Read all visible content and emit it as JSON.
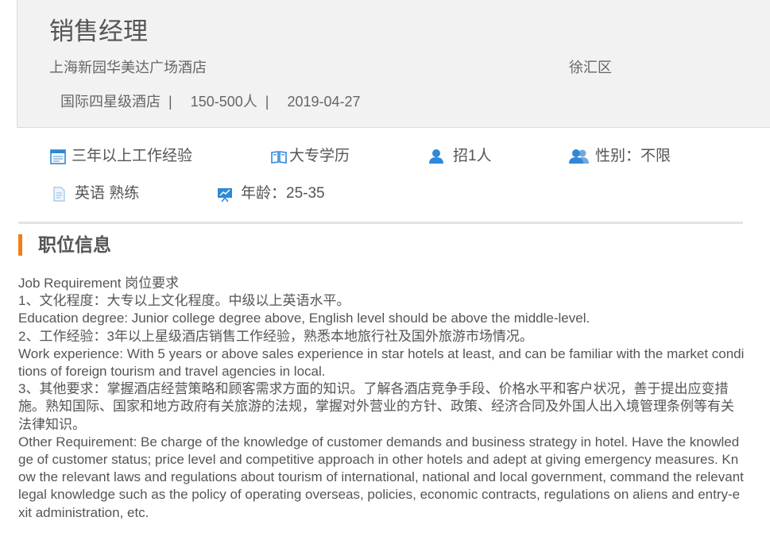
{
  "job": {
    "title": "销售经理",
    "company": "上海新园华美达广场酒店",
    "district": "徐汇区",
    "hotel_type": "国际四星级酒店",
    "sep": "|",
    "size": "150-500人",
    "date": "2019-04-27"
  },
  "attributes": {
    "experience": {
      "icon": "calendar-icon",
      "label": "三年以上工作经验"
    },
    "education": {
      "icon": "book-icon",
      "label": "大专学历"
    },
    "headcount": {
      "icon": "person-icon",
      "label": "招1人"
    },
    "gender": {
      "icon": "people-icon",
      "label": "性别：不限"
    },
    "language": {
      "icon": "document-icon",
      "label": "英语 熟练"
    },
    "age": {
      "icon": "presentation-icon",
      "label": "年龄：25-35"
    }
  },
  "colors": {
    "accent": "#f07f1a",
    "icon_blue": "#2f88d8"
  },
  "section": {
    "title": "职位信息"
  },
  "description": [
    "Job Requirement 岗位要求",
    "1、文化程度：大专以上文化程度。中级以上英语水平。",
    "Education degree: Junior college degree above, English level should be above the middle-level.",
    "2、工作经验：3年以上星级酒店销售工作经验，熟悉本地旅行社及国外旅游市场情况。",
    "Work experience: With 5 years or above sales experience in star hotels at least, and can be familiar with the market conditions of foreign tourism and travel agencies in local.",
    "3、其他要求：掌握酒店经营策略和顾客需求方面的知识。了解各酒店竞争手段、价格水平和客户状况，善于提出应变措施。熟知国际、国家和地方政府有关旅游的法规，掌握对外营业的方针、政策、经济合同及外国人出入境管理条例等有关法律知识。",
    "Other Requirement: Be charge of the knowledge of customer demands and business strategy in hotel. Have the knowledge of customer status; price level and competitive approach in other hotels and adept at giving emergency measures. Know the relevant laws and regulations about tourism of international, national and local government, command the relevant legal knowledge such as the policy of operating overseas, policies, economic contracts, regulations on aliens and entry-exit administration, etc."
  ]
}
